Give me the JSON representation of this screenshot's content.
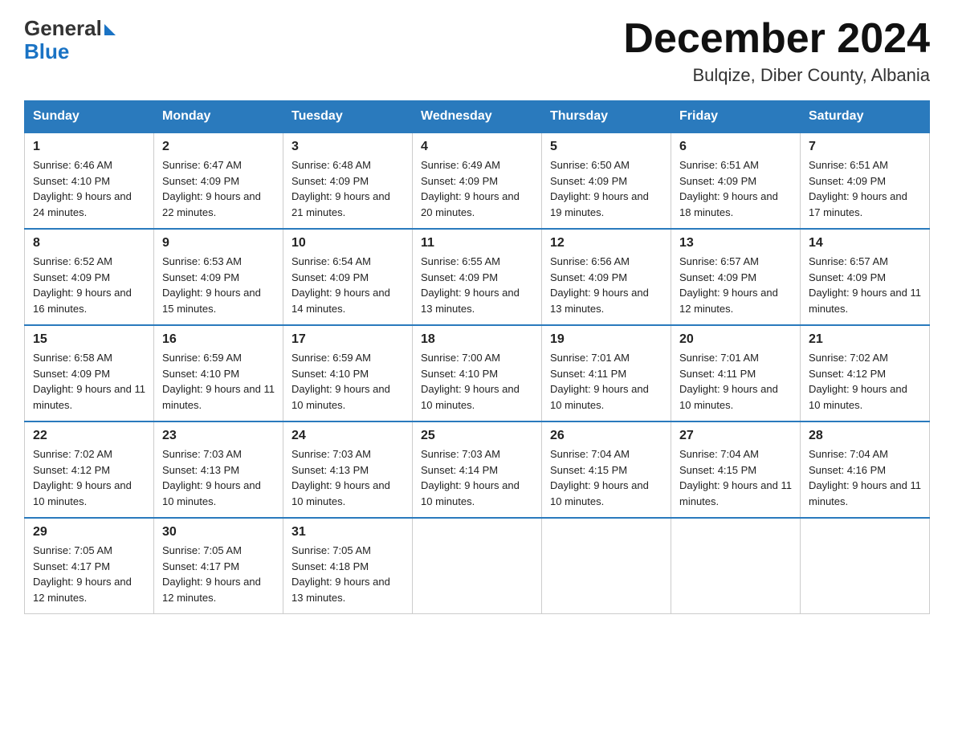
{
  "header": {
    "logo_general": "General",
    "logo_blue": "Blue",
    "month_title": "December 2024",
    "location": "Bulqize, Diber County, Albania"
  },
  "days_of_week": [
    "Sunday",
    "Monday",
    "Tuesday",
    "Wednesday",
    "Thursday",
    "Friday",
    "Saturday"
  ],
  "weeks": [
    [
      {
        "date": "1",
        "sunrise": "Sunrise: 6:46 AM",
        "sunset": "Sunset: 4:10 PM",
        "daylight": "Daylight: 9 hours and 24 minutes."
      },
      {
        "date": "2",
        "sunrise": "Sunrise: 6:47 AM",
        "sunset": "Sunset: 4:09 PM",
        "daylight": "Daylight: 9 hours and 22 minutes."
      },
      {
        "date": "3",
        "sunrise": "Sunrise: 6:48 AM",
        "sunset": "Sunset: 4:09 PM",
        "daylight": "Daylight: 9 hours and 21 minutes."
      },
      {
        "date": "4",
        "sunrise": "Sunrise: 6:49 AM",
        "sunset": "Sunset: 4:09 PM",
        "daylight": "Daylight: 9 hours and 20 minutes."
      },
      {
        "date": "5",
        "sunrise": "Sunrise: 6:50 AM",
        "sunset": "Sunset: 4:09 PM",
        "daylight": "Daylight: 9 hours and 19 minutes."
      },
      {
        "date": "6",
        "sunrise": "Sunrise: 6:51 AM",
        "sunset": "Sunset: 4:09 PM",
        "daylight": "Daylight: 9 hours and 18 minutes."
      },
      {
        "date": "7",
        "sunrise": "Sunrise: 6:51 AM",
        "sunset": "Sunset: 4:09 PM",
        "daylight": "Daylight: 9 hours and 17 minutes."
      }
    ],
    [
      {
        "date": "8",
        "sunrise": "Sunrise: 6:52 AM",
        "sunset": "Sunset: 4:09 PM",
        "daylight": "Daylight: 9 hours and 16 minutes."
      },
      {
        "date": "9",
        "sunrise": "Sunrise: 6:53 AM",
        "sunset": "Sunset: 4:09 PM",
        "daylight": "Daylight: 9 hours and 15 minutes."
      },
      {
        "date": "10",
        "sunrise": "Sunrise: 6:54 AM",
        "sunset": "Sunset: 4:09 PM",
        "daylight": "Daylight: 9 hours and 14 minutes."
      },
      {
        "date": "11",
        "sunrise": "Sunrise: 6:55 AM",
        "sunset": "Sunset: 4:09 PM",
        "daylight": "Daylight: 9 hours and 13 minutes."
      },
      {
        "date": "12",
        "sunrise": "Sunrise: 6:56 AM",
        "sunset": "Sunset: 4:09 PM",
        "daylight": "Daylight: 9 hours and 13 minutes."
      },
      {
        "date": "13",
        "sunrise": "Sunrise: 6:57 AM",
        "sunset": "Sunset: 4:09 PM",
        "daylight": "Daylight: 9 hours and 12 minutes."
      },
      {
        "date": "14",
        "sunrise": "Sunrise: 6:57 AM",
        "sunset": "Sunset: 4:09 PM",
        "daylight": "Daylight: 9 hours and 11 minutes."
      }
    ],
    [
      {
        "date": "15",
        "sunrise": "Sunrise: 6:58 AM",
        "sunset": "Sunset: 4:09 PM",
        "daylight": "Daylight: 9 hours and 11 minutes."
      },
      {
        "date": "16",
        "sunrise": "Sunrise: 6:59 AM",
        "sunset": "Sunset: 4:10 PM",
        "daylight": "Daylight: 9 hours and 11 minutes."
      },
      {
        "date": "17",
        "sunrise": "Sunrise: 6:59 AM",
        "sunset": "Sunset: 4:10 PM",
        "daylight": "Daylight: 9 hours and 10 minutes."
      },
      {
        "date": "18",
        "sunrise": "Sunrise: 7:00 AM",
        "sunset": "Sunset: 4:10 PM",
        "daylight": "Daylight: 9 hours and 10 minutes."
      },
      {
        "date": "19",
        "sunrise": "Sunrise: 7:01 AM",
        "sunset": "Sunset: 4:11 PM",
        "daylight": "Daylight: 9 hours and 10 minutes."
      },
      {
        "date": "20",
        "sunrise": "Sunrise: 7:01 AM",
        "sunset": "Sunset: 4:11 PM",
        "daylight": "Daylight: 9 hours and 10 minutes."
      },
      {
        "date": "21",
        "sunrise": "Sunrise: 7:02 AM",
        "sunset": "Sunset: 4:12 PM",
        "daylight": "Daylight: 9 hours and 10 minutes."
      }
    ],
    [
      {
        "date": "22",
        "sunrise": "Sunrise: 7:02 AM",
        "sunset": "Sunset: 4:12 PM",
        "daylight": "Daylight: 9 hours and 10 minutes."
      },
      {
        "date": "23",
        "sunrise": "Sunrise: 7:03 AM",
        "sunset": "Sunset: 4:13 PM",
        "daylight": "Daylight: 9 hours and 10 minutes."
      },
      {
        "date": "24",
        "sunrise": "Sunrise: 7:03 AM",
        "sunset": "Sunset: 4:13 PM",
        "daylight": "Daylight: 9 hours and 10 minutes."
      },
      {
        "date": "25",
        "sunrise": "Sunrise: 7:03 AM",
        "sunset": "Sunset: 4:14 PM",
        "daylight": "Daylight: 9 hours and 10 minutes."
      },
      {
        "date": "26",
        "sunrise": "Sunrise: 7:04 AM",
        "sunset": "Sunset: 4:15 PM",
        "daylight": "Daylight: 9 hours and 10 minutes."
      },
      {
        "date": "27",
        "sunrise": "Sunrise: 7:04 AM",
        "sunset": "Sunset: 4:15 PM",
        "daylight": "Daylight: 9 hours and 11 minutes."
      },
      {
        "date": "28",
        "sunrise": "Sunrise: 7:04 AM",
        "sunset": "Sunset: 4:16 PM",
        "daylight": "Daylight: 9 hours and 11 minutes."
      }
    ],
    [
      {
        "date": "29",
        "sunrise": "Sunrise: 7:05 AM",
        "sunset": "Sunset: 4:17 PM",
        "daylight": "Daylight: 9 hours and 12 minutes."
      },
      {
        "date": "30",
        "sunrise": "Sunrise: 7:05 AM",
        "sunset": "Sunset: 4:17 PM",
        "daylight": "Daylight: 9 hours and 12 minutes."
      },
      {
        "date": "31",
        "sunrise": "Sunrise: 7:05 AM",
        "sunset": "Sunset: 4:18 PM",
        "daylight": "Daylight: 9 hours and 13 minutes."
      },
      null,
      null,
      null,
      null
    ]
  ]
}
